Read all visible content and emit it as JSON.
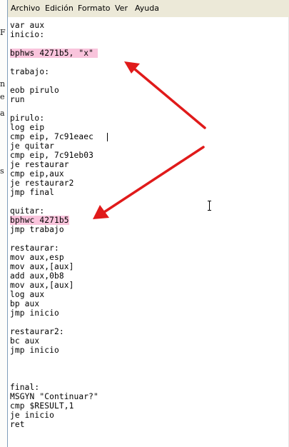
{
  "menu": [
    "Archivo",
    "Edición",
    "Formato",
    "Ver",
    "Ayuda"
  ],
  "background_fragments": [
    "F",
    "n",
    "e",
    "a",
    "s"
  ],
  "code": [
    "var aux",
    "inicio:",
    "",
    "bphws 4271b5, \"x\"",
    "",
    "trabajo:",
    "",
    "eob pirulo",
    "run",
    "",
    "pirulo:",
    "log eip",
    "cmp eip, 7c91eaec",
    "je quitar",
    "cmp eip, 7c91eb03",
    "je restaurar",
    "cmp eip,aux",
    "je restaurar2",
    "jmp final",
    "",
    "quitar:",
    "bphwc 4271b5",
    "jmp trabajo",
    "",
    "restaurar:",
    "mov aux,esp",
    "mov aux,[aux]",
    "add aux,0b8",
    "mov aux,[aux]",
    "log aux",
    "bp aux",
    "jmp inicio",
    "",
    "restaurar2:",
    "bc aux",
    "jmp inicio",
    "",
    "",
    "",
    "final:",
    "MSGYN \"Continuar?\"",
    "cmp $RESULT,1",
    "je inicio",
    "ret"
  ],
  "highlighted_lines": [
    3,
    21
  ],
  "colors": {
    "highlight": "#f9c4dc",
    "arrow": "#e01a1a",
    "menubar": "#ece9d8"
  }
}
